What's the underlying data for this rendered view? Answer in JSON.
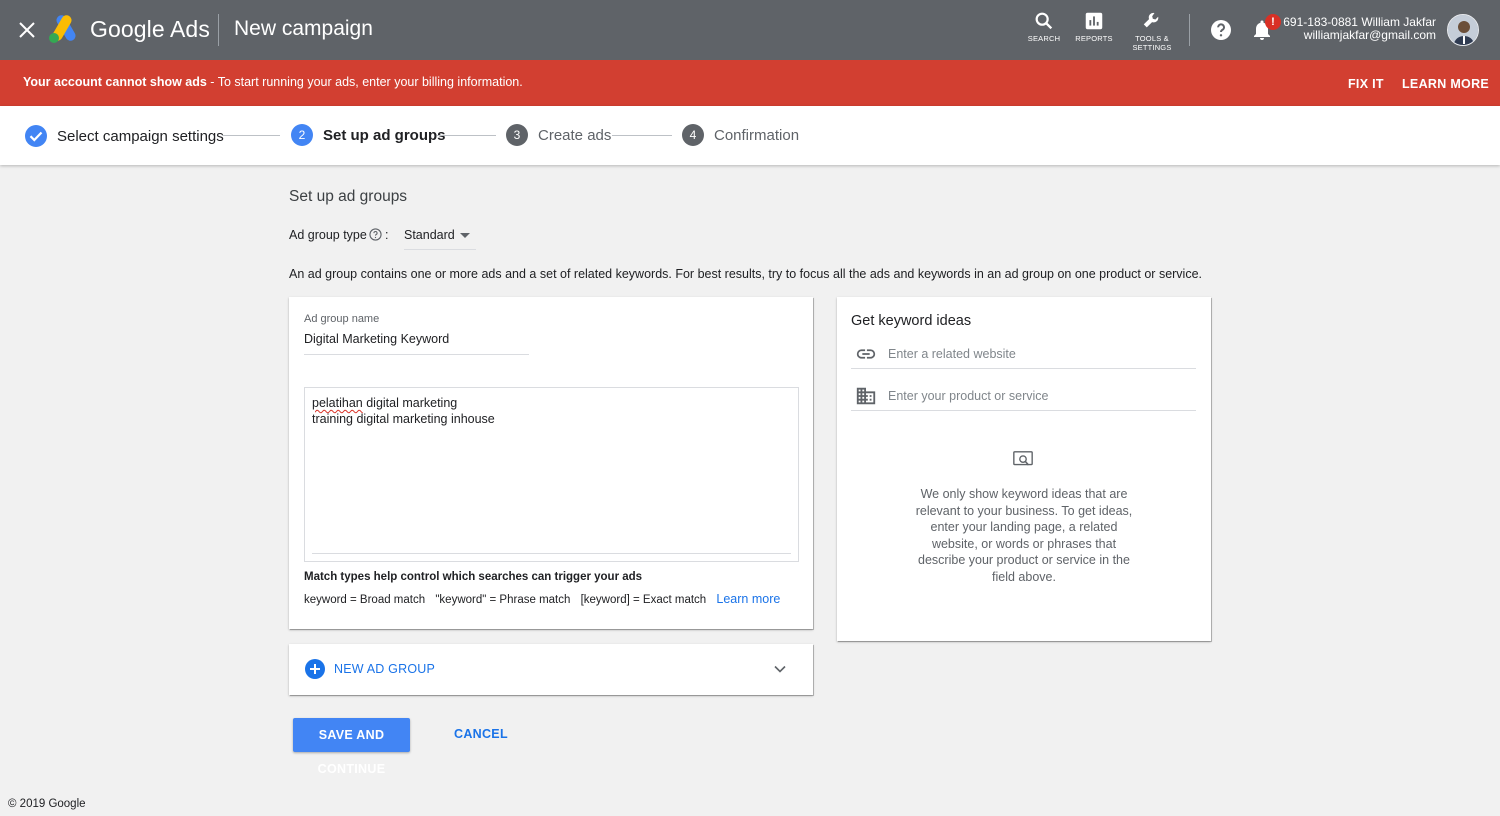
{
  "header": {
    "brand": "Google Ads",
    "page_title": "New campaign",
    "tools": [
      {
        "icon": "search-icon",
        "label": "SEARCH"
      },
      {
        "icon": "reports-icon",
        "label": "REPORTS"
      },
      {
        "icon": "wrench-icon",
        "label_line1": "TOOLS &",
        "label_line2": "SETTINGS"
      }
    ],
    "notification_badge": "!",
    "account_line": "691-183-0881 William Jakfar",
    "account_email": "williamjakfar@gmail.com"
  },
  "alert": {
    "bold_text": "Your account cannot show ads",
    "text": " - To start running your ads, enter your billing information.",
    "fix_label": "FIX IT",
    "learn_label": "LEARN MORE",
    "color": "#d23f31"
  },
  "stepper": {
    "steps": [
      {
        "num": "✓",
        "label": "Select campaign settings",
        "state": "done"
      },
      {
        "num": "2",
        "label": "Set up ad groups",
        "state": "active"
      },
      {
        "num": "3",
        "label": "Create ads",
        "state": "pending"
      },
      {
        "num": "4",
        "label": "Confirmation",
        "state": "pending"
      }
    ],
    "accent": "#4285f4"
  },
  "main": {
    "section_title": "Set up ad groups",
    "ad_group_type_label": "Ad group type",
    "ad_group_type_colon": ":",
    "ad_group_type_value": "Standard",
    "description": "An ad group contains one or more ads and a set of related keywords. For best results, try to focus all the ads and keywords in an ad group on one product or service."
  },
  "ad_group": {
    "name_label": "Ad group name",
    "name_value": "Digital Marketing Keyword",
    "keywords": [
      "pelatihan digital marketing",
      "training digital marketing inhouse"
    ],
    "keyword_misspelled": "pelatihan",
    "keyword_rest": " digital marketing",
    "match_title": "Match types help control which searches can trigger your ads",
    "match_broad": "keyword = Broad match",
    "match_phrase": "\"keyword\" = Phrase match",
    "match_exact": "[keyword] = Exact match",
    "learn_more": "Learn more"
  },
  "keyword_ideas": {
    "title": "Get keyword ideas",
    "website_placeholder": "Enter a related website",
    "product_placeholder": "Enter your product or service",
    "empty_text": "We only show keyword ideas that are relevant to your business. To get ideas, enter your landing page, a related website, or words or phrases that describe your product or service in the field above."
  },
  "new_group": {
    "label": "NEW AD GROUP"
  },
  "actions": {
    "save_label": "SAVE AND CONTINUE",
    "cancel_label": "CANCEL"
  },
  "footer": {
    "text": "© 2019 Google"
  }
}
